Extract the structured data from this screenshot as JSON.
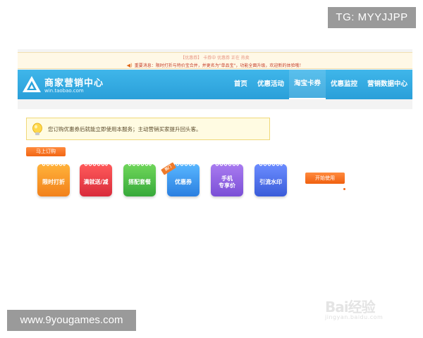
{
  "overlay": {
    "tg_badge": "TG: MYYJJPP",
    "site_badge": "www.9yougames.com"
  },
  "notice": {
    "line1": "【优惠券】 卡券中 优惠券 正在 热卖",
    "line2": "重要消息：限时打折与特价宝合并，并更名为\"单品宝\"，功能全面升级，欢迎新的体验哦！",
    "icon": "speaker-icon"
  },
  "header": {
    "logo_title": "商家营销中心",
    "logo_sub": "win.taobao.com",
    "nav": [
      {
        "label": "首页",
        "active": false
      },
      {
        "label": "优惠活动",
        "active": false
      },
      {
        "label": "淘宝卡券",
        "active": true
      },
      {
        "label": "优惠监控",
        "active": false
      },
      {
        "label": "营销数据中心",
        "active": false
      }
    ]
  },
  "content": {
    "tip": "您订购优惠券后就能立即使用本服务；主动营销买家提升回头客。",
    "order_button": "马上订购",
    "tiles": [
      {
        "label": "限时打折",
        "color": "#f2811b"
      },
      {
        "label": "满就送/减",
        "color": "#d92b3b"
      },
      {
        "label": "搭配套餐",
        "color": "#37a93a"
      },
      {
        "label": "优惠券",
        "color": "#2b7fe0",
        "ribbon": "热门"
      },
      {
        "label1": "手机",
        "label2": "专享价",
        "color": "#7a4fd6"
      },
      {
        "label": "引流水印",
        "color": "#3a5cd9"
      }
    ],
    "start_button": "开始使用"
  },
  "watermark": {
    "logo": "Bai经验",
    "url": "jingyan.baidu.com"
  }
}
